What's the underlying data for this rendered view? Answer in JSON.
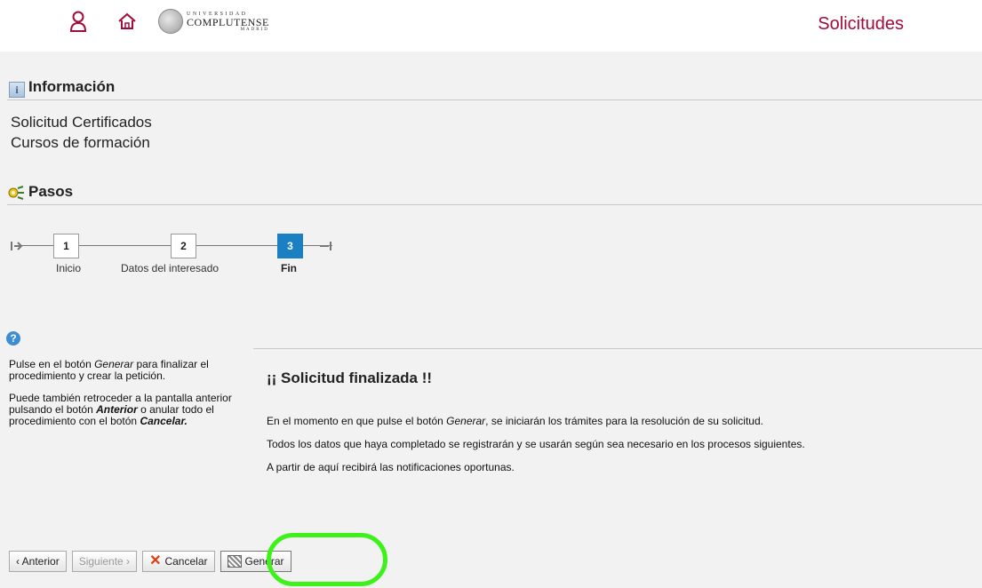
{
  "header": {
    "logo_top": "UNIVERSIDAD",
    "logo_mid": "COMPLUTENSE",
    "logo_bot": "MADRID",
    "app_title": "Solicitudes"
  },
  "info": {
    "heading": "Información",
    "lines": [
      "Solicitud Certificados",
      "Cursos de formación"
    ]
  },
  "pasos": {
    "heading": "Pasos",
    "steps": [
      {
        "number": "1",
        "label": "Inicio",
        "active": false
      },
      {
        "number": "2",
        "label": "Datos del interesado",
        "active": false
      },
      {
        "number": "3",
        "label": "Fin",
        "active": true
      }
    ]
  },
  "help": {
    "icon": "?",
    "p1_a": "Pulse en el botón ",
    "p1_em": "Generar",
    "p1_b": " para finalizar el procedimiento y crear la petición.",
    "p2_a": "Puede también retroceder a la pantalla anterior pulsando el botón ",
    "p2_em1": "Anterior",
    "p2_b": " o anular todo el procedimiento con el botón ",
    "p2_em2": "Cancelar."
  },
  "main": {
    "title": "¡¡ Solicitud finalizada !!",
    "line1_a": "En el momento en que pulse el botón ",
    "line1_em": "Generar",
    "line1_b": ", se iniciarán los trámites para la resolución de su solicitud.",
    "line2": "Todos los datos que haya completado se registrarán y se usarán según sea necesario en los procesos siguientes.",
    "line3": "A partir de aquí recibirá las notificaciones oportunas."
  },
  "buttons": {
    "anterior": "‹ Anterior",
    "siguiente": "Siguiente ›",
    "cancelar": "Cancelar",
    "generar": "Generar"
  },
  "colors": {
    "brand": "#a30b3a",
    "step_active": "#1b7fc4",
    "highlight": "#3cf218"
  }
}
